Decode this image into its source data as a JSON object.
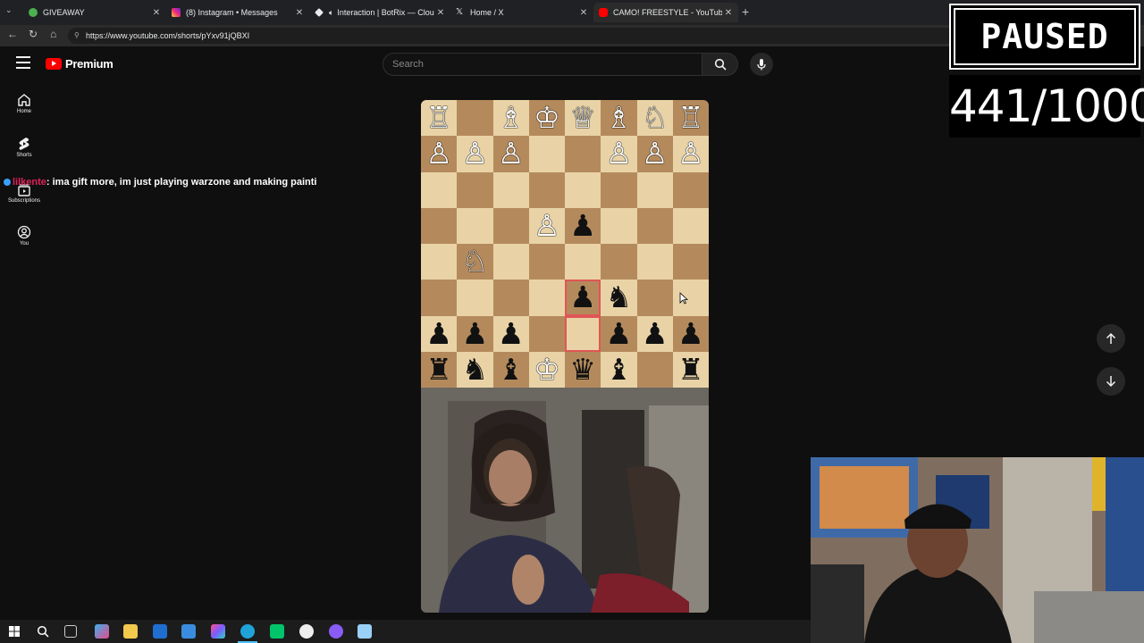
{
  "browser": {
    "tabs": [
      {
        "title": "GIVEAWAY",
        "favicon_color": "#4caf50",
        "active": false
      },
      {
        "title": "(8) Instagram • Messages",
        "favicon_color": "#d6249f",
        "active": false
      },
      {
        "title": "Interaction | BotRix — Cloud S",
        "favicon_color": "#e8eaed",
        "active": false
      },
      {
        "title": "Home / X",
        "favicon_color": "#e8eaed",
        "active": false
      },
      {
        "title": "CAMO! FREESTYLE - YouTube",
        "favicon_color": "#ff0000",
        "active": true
      }
    ],
    "url": "https://www.youtube.com/shorts/pYxv91jQBXI"
  },
  "youtube": {
    "logo_text": "Premium",
    "search_placeholder": "Search",
    "sidebar": [
      {
        "label": "Home",
        "icon": "home-icon"
      },
      {
        "label": "Shorts",
        "icon": "shorts-icon"
      },
      {
        "label": "Subscriptions",
        "icon": "subscriptions-icon"
      },
      {
        "label": "You",
        "icon": "you-icon"
      }
    ]
  },
  "chat_overlay": {
    "username": "lilkente",
    "message": ": ima gift more, im just playing warzone and making painti"
  },
  "chess": {
    "rows": [
      [
        "♖",
        "",
        "♗",
        "♔",
        "♕",
        "♗",
        "♘",
        "♖"
      ],
      [
        "♙",
        "♙",
        "♙",
        "",
        "",
        "♙",
        "♙",
        "♙"
      ],
      [
        "",
        "",
        "",
        "",
        "",
        "",
        "",
        ""
      ],
      [
        "",
        "",
        "",
        "♙",
        "♟",
        "",
        "",
        ""
      ],
      [
        "",
        "♘",
        "",
        "",
        "",
        "",
        "",
        ""
      ],
      [
        "",
        "",
        "",
        "",
        "♟",
        "♞",
        "",
        ""
      ],
      [
        "♟",
        "♟",
        "♟",
        "",
        "",
        "♟",
        "♟",
        "♟"
      ],
      [
        "♜",
        "♞",
        "♝",
        "♔",
        "♛",
        "♝",
        "",
        "♜"
      ]
    ],
    "light_color": "#e9d3a6",
    "dark_color": "#b48a5c",
    "highlight_color": "#e05555"
  },
  "overlay": {
    "status": "PAUSED",
    "counter": "441/1000"
  }
}
